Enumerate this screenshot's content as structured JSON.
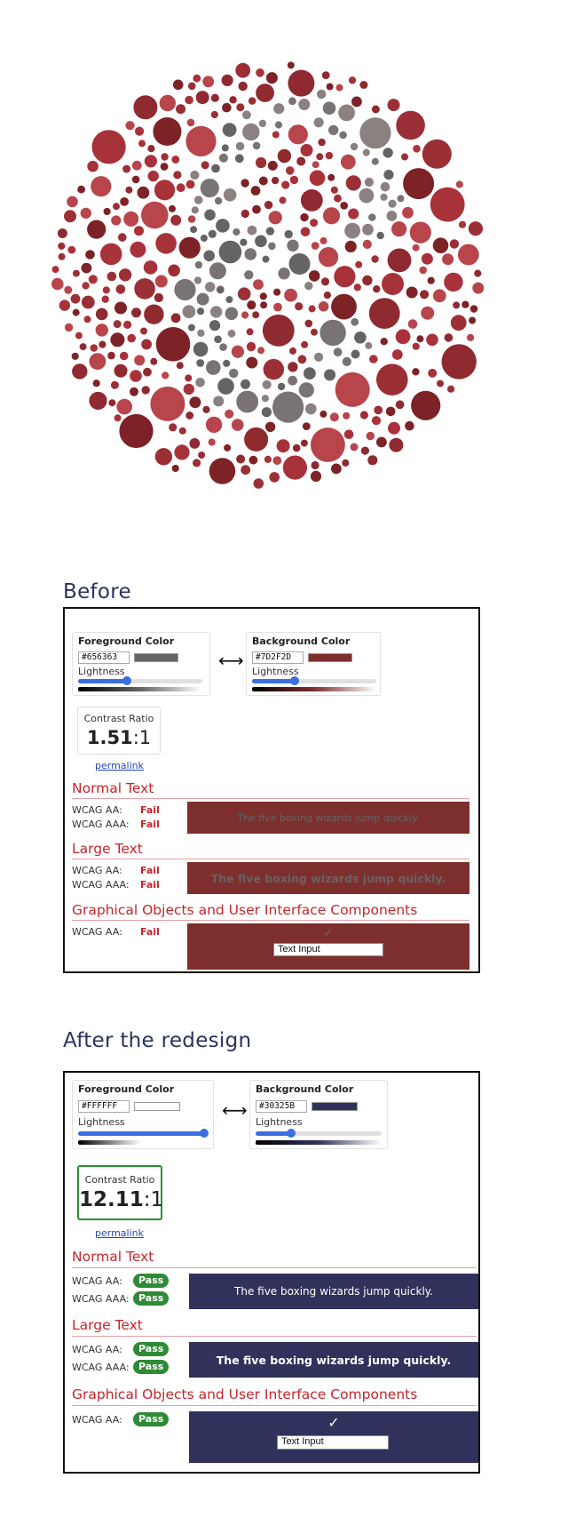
{
  "before": {
    "heading": "Before",
    "foreground": {
      "title": "Foreground Color",
      "hex": "#656363",
      "color": "#656363",
      "lightness_label": "Lightness",
      "lightness_pct": 39
    },
    "background": {
      "title": "Background Color",
      "hex": "#7D2F2D",
      "color": "#7D2F2D",
      "lightness_label": "Lightness",
      "lightness_pct": 34
    },
    "swap_symbol": "⟷",
    "ratio": {
      "title": "Contrast Ratio",
      "value": "1.51",
      "suffix": ":1"
    },
    "permalink": "permalink",
    "sections": {
      "normal": {
        "title": "Normal Text",
        "aa_label": "WCAG AA:",
        "aa_result": "Fail",
        "aaa_label": "WCAG AAA:",
        "aaa_result": "Fail",
        "sample": "The five boxing wizards jump quickly."
      },
      "large": {
        "title": "Large Text",
        "aa_label": "WCAG AA:",
        "aa_result": "Fail",
        "aaa_label": "WCAG AAA:",
        "aaa_result": "Fail",
        "sample": "The five boxing wizards jump quickly."
      },
      "graphical": {
        "title": "Graphical Objects and User Interface Components",
        "aa_label": "WCAG AA:",
        "aa_result": "Fail",
        "check": "✓",
        "input_value": "Text Input"
      }
    }
  },
  "after": {
    "heading": "After the redesign",
    "foreground": {
      "title": "Foreground Color",
      "hex": "#FFFFFF",
      "color": "#FFFFFF",
      "lightness_label": "Lightness",
      "lightness_pct": 100
    },
    "background": {
      "title": "Background Color",
      "hex": "#30325B",
      "color": "#30325B",
      "lightness_label": "Lightness",
      "lightness_pct": 28
    },
    "swap_symbol": "⟷",
    "ratio": {
      "title": "Contrast Ratio",
      "value": "12.11",
      "suffix": ":1"
    },
    "permalink": "permalink",
    "sections": {
      "normal": {
        "title": "Normal Text",
        "aa_label": "WCAG AA:",
        "aa_result": "Pass",
        "aaa_label": "WCAG AAA:",
        "aaa_result": "Pass",
        "sample": "The five boxing wizards jump quickly."
      },
      "large": {
        "title": "Large Text",
        "aa_label": "WCAG AA:",
        "aa_result": "Pass",
        "aaa_label": "WCAG AAA:",
        "aaa_result": "Pass",
        "sample": "The five boxing wizards jump quickly."
      },
      "graphical": {
        "title": "Graphical Objects and User Interface Components",
        "aa_label": "WCAG AA:",
        "aa_result": "Pass",
        "check": "✓",
        "input_value": "Text Input"
      }
    }
  },
  "plate_colors": {
    "figure": [
      "#656363",
      "#8c8181",
      "#7a7373"
    ],
    "ground": [
      "#8e2a30",
      "#a8323a",
      "#b7454b",
      "#9b2f36",
      "#7d2226"
    ]
  }
}
